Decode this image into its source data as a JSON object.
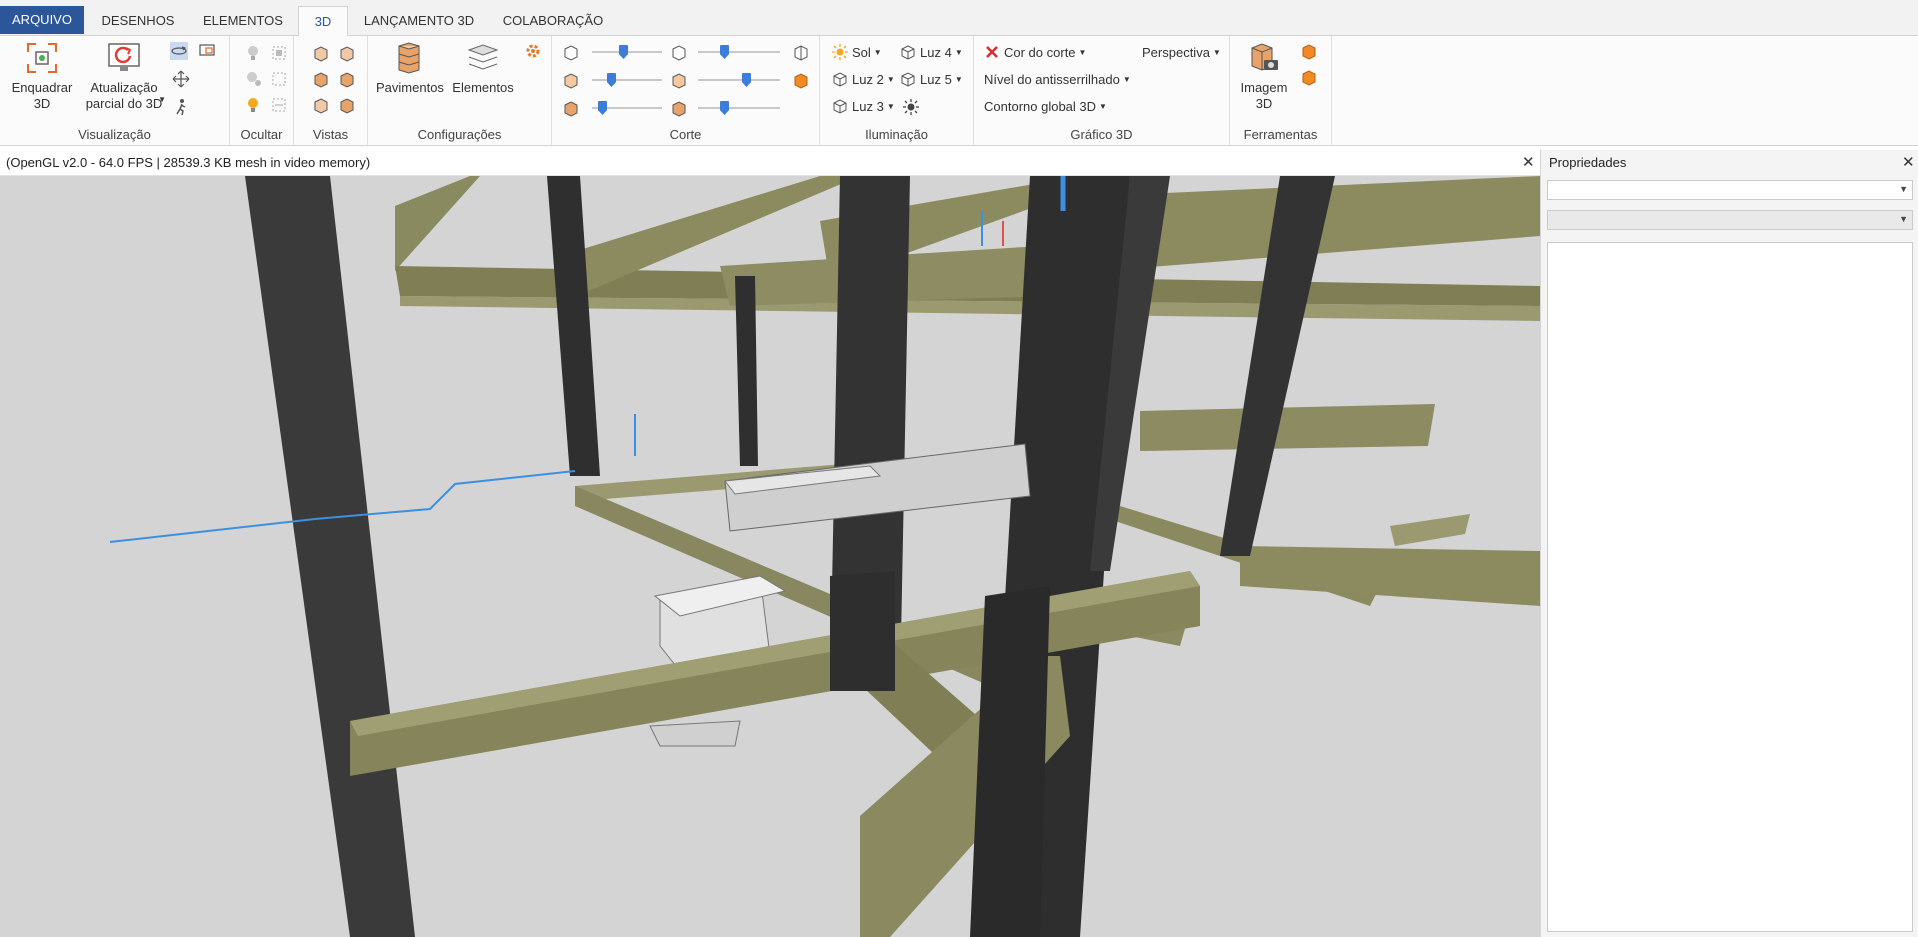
{
  "tabs": [
    {
      "label": "ARQUIVO",
      "state": "file"
    },
    {
      "label": "DESENHOS",
      "state": ""
    },
    {
      "label": "ELEMENTOS",
      "state": ""
    },
    {
      "label": "3D",
      "state": "active"
    },
    {
      "label": "LANÇAMENTO 3D",
      "state": ""
    },
    {
      "label": "COLABORAÇÃO",
      "state": ""
    }
  ],
  "ribbon": {
    "visualizacao": {
      "label": "Visualização",
      "enquadrar": "Enquadrar\n3D",
      "atualizacao": "Atualização\nparcial do 3D"
    },
    "ocultar": {
      "label": "Ocultar"
    },
    "vistas": {
      "label": "Vistas"
    },
    "configuracoes": {
      "label": "Configurações",
      "pavimentos": "Pavimentos",
      "elementos": "Elementos"
    },
    "corte": {
      "label": "Corte",
      "sliders": [
        0.45,
        0.3,
        0.25,
        0.6,
        0.1,
        0.3
      ]
    },
    "iluminacao": {
      "label": "Iluminação",
      "sol": "Sol",
      "luz2": "Luz 2",
      "luz3": "Luz 3",
      "luz4": "Luz 4",
      "luz5": "Luz 5"
    },
    "grafico3d": {
      "label": "Gráfico 3D",
      "cor_corte": "Cor do corte",
      "perspectiva": "Perspectiva",
      "antisserrilhado": "Nível do antisserrilhado",
      "contorno": "Contorno global 3D"
    },
    "ferramentas": {
      "label": "Ferramentas",
      "imagem": "Imagem\n3D"
    }
  },
  "viewport": {
    "info": "(OpenGL v2.0 - 64.0 FPS | 28539.3 KB mesh in video memory)"
  },
  "properties": {
    "title": "Propriedades"
  },
  "colors": {
    "accent": "#2b579a",
    "beam": "#8b8a5e",
    "column": "#3a3a3a",
    "background": "#d4d4d4",
    "pipe": "#3d8fe0"
  }
}
